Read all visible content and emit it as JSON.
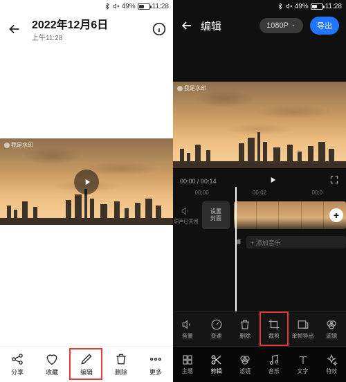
{
  "status": {
    "battery_pct": "49%",
    "time": "11:28"
  },
  "left": {
    "title": "2022年12月6日",
    "subtitle": "上午11:28",
    "watermark": "我是水印",
    "bottom": [
      {
        "name": "share",
        "label": "分享"
      },
      {
        "name": "favorite",
        "label": "收藏"
      },
      {
        "name": "edit",
        "label": "编辑"
      },
      {
        "name": "delete",
        "label": "删除"
      },
      {
        "name": "more",
        "label": "更多"
      }
    ]
  },
  "right": {
    "title": "编辑",
    "resolution": "1080P",
    "export": "导出",
    "watermark": "我是水印",
    "time_current": "00:00",
    "time_total": "00:14",
    "ruler": [
      "00:00",
      "00:02",
      "00:0"
    ],
    "sound_off": "原声已关闭",
    "cover_btn_l1": "设置",
    "cover_btn_l2": "封面",
    "add_music": "+ 添加音乐",
    "row1": [
      {
        "name": "volume",
        "label": "音量"
      },
      {
        "name": "speed",
        "label": "变速"
      },
      {
        "name": "delete",
        "label": "删除"
      },
      {
        "name": "crop",
        "label": "裁剪"
      },
      {
        "name": "export-frame",
        "label": "单帧导出"
      },
      {
        "name": "filter",
        "label": "滤镜"
      }
    ],
    "row2": [
      {
        "name": "theme",
        "label": "主题"
      },
      {
        "name": "clip",
        "label": "剪辑"
      },
      {
        "name": "filter",
        "label": "滤镜"
      },
      {
        "name": "music",
        "label": "音乐"
      },
      {
        "name": "text",
        "label": "文字"
      },
      {
        "name": "effect",
        "label": "特效"
      }
    ]
  }
}
